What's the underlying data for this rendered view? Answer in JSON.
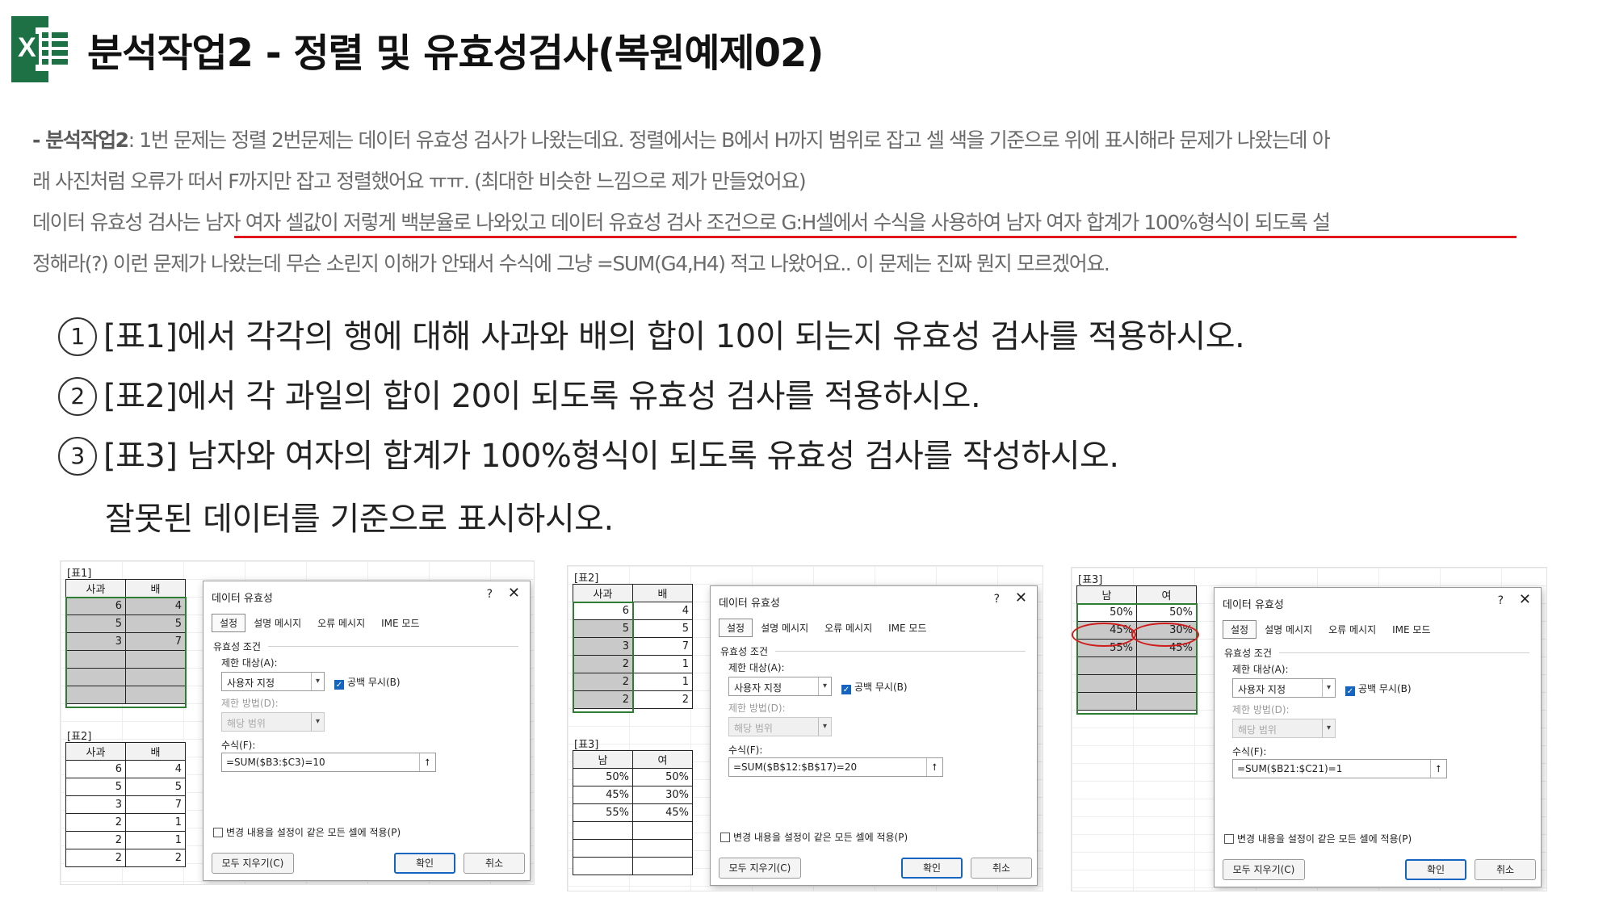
{
  "header": {
    "logo_text": "X",
    "title": "분석작업2 - 정렬 및 유효성검사(복원예제02)"
  },
  "excerpt": {
    "line1_bold": "- 분석작업2",
    "line1_rest": ": 1번 문제는 정렬 2번문제는 데이터 유효성 검사가 나왔는데요. 정렬에서는 B에서 H까지 범위로 잡고 셀 색을 기준으로 위에 표시해라 문제가 나왔는데 아",
    "line2": "래 사진처럼 오류가 떠서 F까지만 잡고 정렬했어요 ㅠㅠ. (최대한 비슷한 느낌으로 제가 만들었어요)",
    "line3_pre": "데이터 유효성 검사는 ",
    "line3_hl": "남자 여자 셀값이 저렇게 백분율로 나와있고 데이터 유효성 검사 조건으로 G:H셀에서 수식을 사용하여 남자 여자 합계가 100%형식이 되도록 설",
    "line4": "정해라(?) 이런 문제가 나왔는데 무슨 소린지 이해가 안돼서 수식에 그냥 =SUM(G4,H4) 적고 나왔어요.. 이 문제는 진짜 뭔지 모르겠어요."
  },
  "questions": [
    {
      "num": "1",
      "text": "[표1]에서 각각의 행에 대해 사과와 배의 합이 10이 되는지 유효성 검사를 적용하시오."
    },
    {
      "num": "2",
      "text": "[표2]에서 각 과일의 합이 20이 되도록 유효성 검사를 적용하시오."
    },
    {
      "num": "3",
      "text": "[표3] 남자와 여자의  합계가 100%형식이 되도록 유효성 검사를 작성하시오."
    }
  ],
  "question3_cont": "잘못된 데이터를 기준으로 표시하시오.",
  "panel1": {
    "table1_label": "[표1]",
    "table1_headers": [
      "사과",
      "배"
    ],
    "table1_rows": [
      [
        "6",
        "4"
      ],
      [
        "5",
        "5"
      ],
      [
        "3",
        "7"
      ],
      [
        "",
        ""
      ],
      [
        "",
        ""
      ],
      [
        "",
        ""
      ]
    ],
    "table2_label": "[표2]",
    "table2_headers": [
      "사과",
      "배"
    ],
    "table2_rows": [
      [
        "6",
        "4"
      ],
      [
        "5",
        "5"
      ],
      [
        "3",
        "7"
      ],
      [
        "2",
        "1"
      ],
      [
        "2",
        "1"
      ],
      [
        "2",
        "2"
      ]
    ],
    "formula": "=SUM($B3:$C3)=10"
  },
  "panel2": {
    "table2_label": "[표2]",
    "table2_headers": [
      "사과",
      "배"
    ],
    "table2_rows": [
      [
        "6",
        "4"
      ],
      [
        "5",
        "5"
      ],
      [
        "3",
        "7"
      ],
      [
        "2",
        "1"
      ],
      [
        "2",
        "1"
      ],
      [
        "2",
        "2"
      ]
    ],
    "table3_label": "[표3]",
    "table3_headers": [
      "남",
      "여"
    ],
    "table3_rows": [
      [
        "50%",
        "50%"
      ],
      [
        "45%",
        "30%"
      ],
      [
        "55%",
        "45%"
      ],
      [
        "",
        ""
      ],
      [
        "",
        ""
      ],
      [
        "",
        ""
      ]
    ],
    "formula": "=SUM($B$12:$B$17)=20"
  },
  "panel3": {
    "table3_label": "[표3]",
    "table3_headers": [
      "남",
      "여"
    ],
    "table3_rows": [
      [
        "50%",
        "50%"
      ],
      [
        "45%",
        "30%"
      ],
      [
        "55%",
        "45%"
      ],
      [
        "",
        ""
      ],
      [
        "",
        ""
      ],
      [
        "",
        ""
      ]
    ],
    "formula": "=SUM($B21:$C21)=1"
  },
  "dialog": {
    "title": "데이터 유효성",
    "help": "?",
    "close": "✕",
    "tabs": [
      "설정",
      "설명 메시지",
      "오류 메시지",
      "IME 모드"
    ],
    "section": "유효성 조건",
    "allow_label": "제한 대상(A):",
    "allow_value": "사용자 지정",
    "ignore_blank": "공백 무시(B)",
    "data_label": "제한 방법(D):",
    "data_value": "해당 범위",
    "formula_label": "수식(F):",
    "apply_all": "변경 내용을 설정이 같은 모든 셀에 적용(P)",
    "clear_all": "모두 지우기(C)",
    "ok": "확인",
    "cancel": "취소"
  },
  "colors": {
    "accent_red": "#e0181e",
    "excel_green": "#1e7145"
  }
}
